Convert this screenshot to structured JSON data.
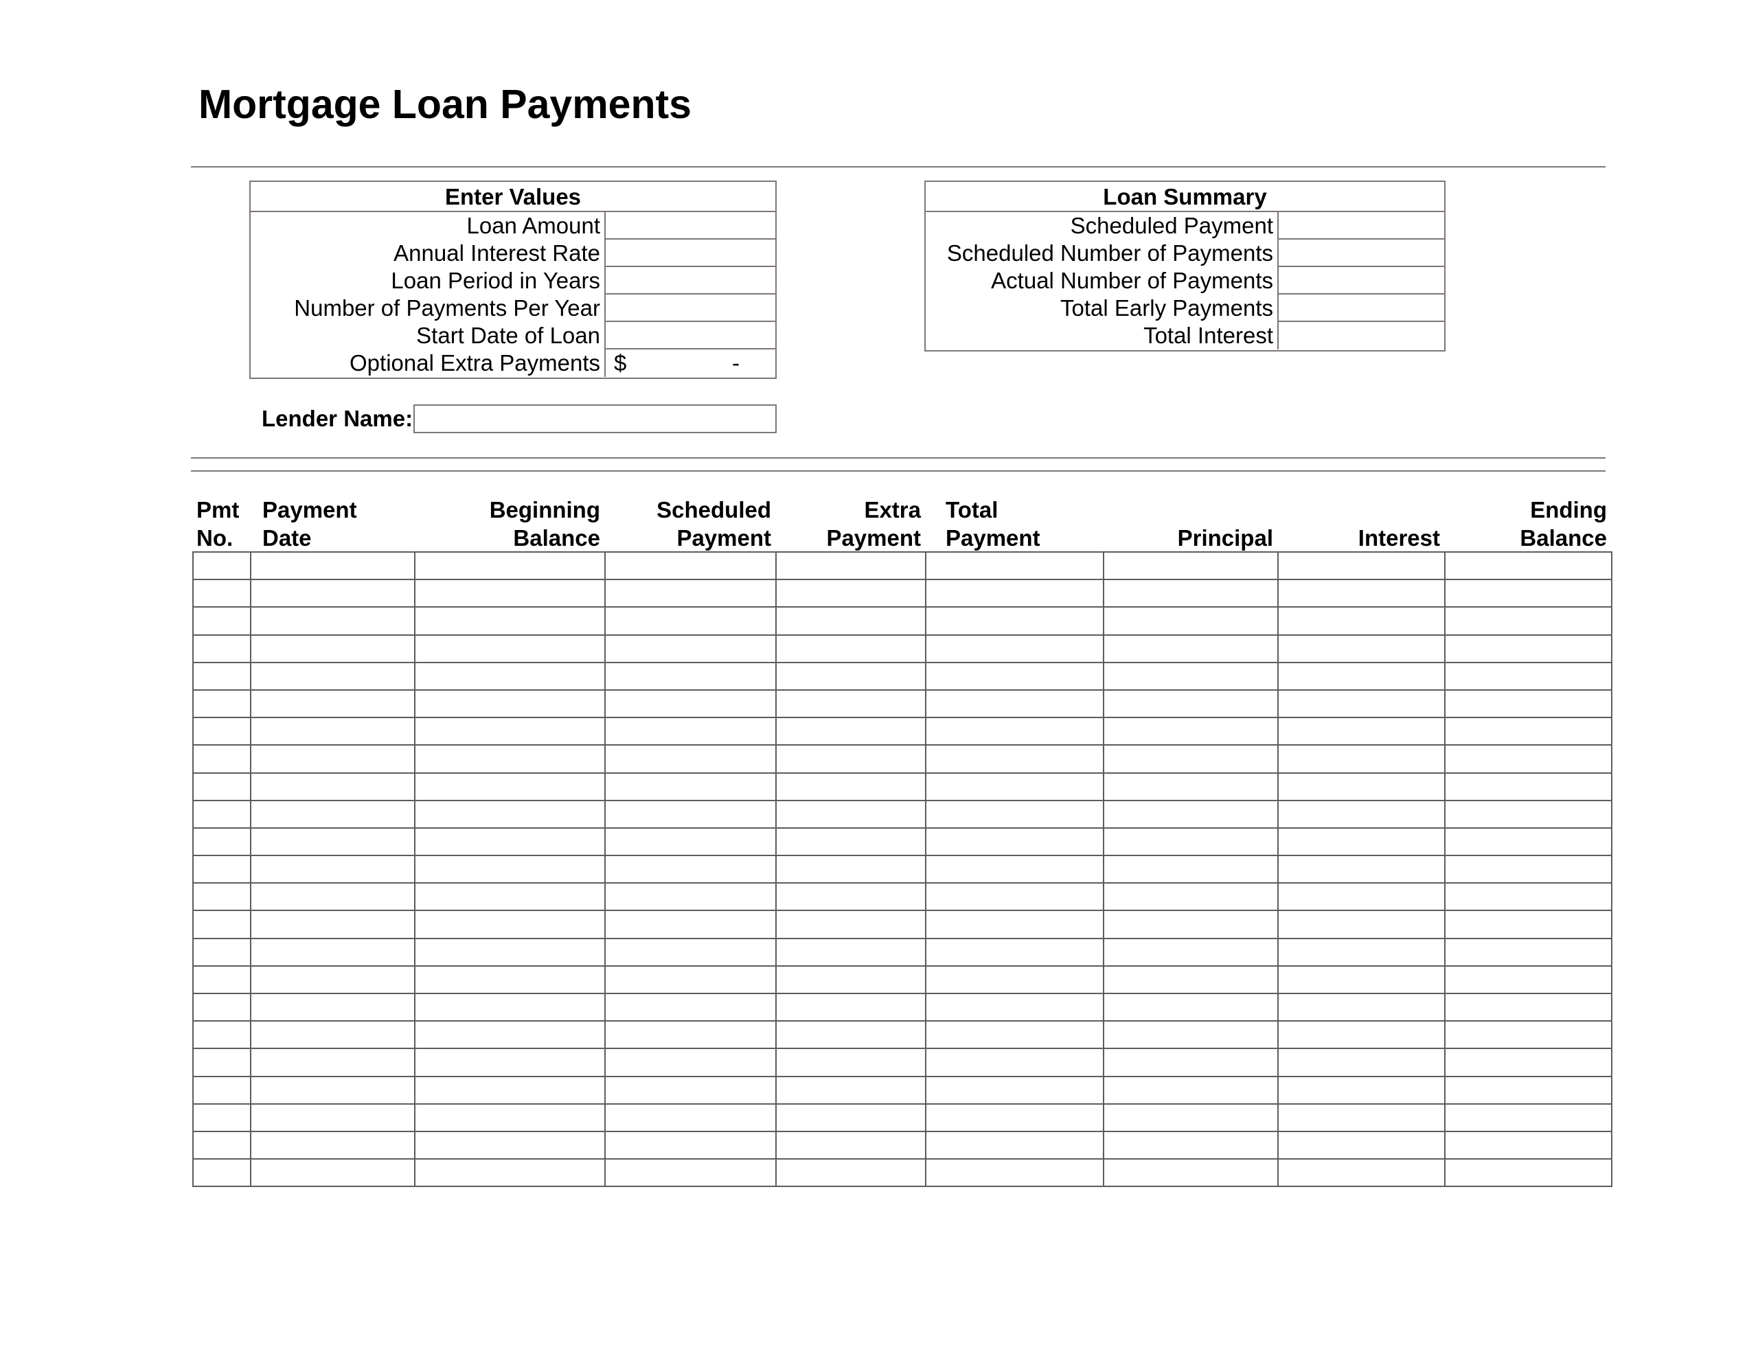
{
  "title": "Mortgage Loan Payments",
  "enter_values": {
    "heading": "Enter Values",
    "fields": [
      {
        "label": "Loan Amount",
        "value": ""
      },
      {
        "label": "Annual Interest Rate",
        "value": ""
      },
      {
        "label": "Loan Period in Years",
        "value": ""
      },
      {
        "label": "Number of Payments Per Year",
        "value": ""
      },
      {
        "label": "Start Date of Loan",
        "value": ""
      },
      {
        "label": "Optional Extra Payments",
        "currency": "$",
        "value": "-"
      }
    ]
  },
  "loan_summary": {
    "heading": "Loan Summary",
    "fields": [
      {
        "label": "Scheduled Payment",
        "value": ""
      },
      {
        "label": "Scheduled Number of Payments",
        "value": ""
      },
      {
        "label": "Actual Number of Payments",
        "value": ""
      },
      {
        "label": "Total Early Payments",
        "value": ""
      },
      {
        "label": "Total Interest",
        "value": ""
      }
    ]
  },
  "lender": {
    "label": "Lender Name:",
    "value": ""
  },
  "schedule": {
    "columns": [
      {
        "line1": "Pmt",
        "line2": "No."
      },
      {
        "line1": "",
        "line2": "Payment Date"
      },
      {
        "line1": "Beginning",
        "line2": "Balance"
      },
      {
        "line1": "Scheduled",
        "line2": "Payment"
      },
      {
        "line1": "Extra",
        "line2": "Payment"
      },
      {
        "line1": "",
        "line2": "Total Payment"
      },
      {
        "line1": "",
        "line2": "Principal"
      },
      {
        "line1": "",
        "line2": "Interest"
      },
      {
        "line1": "Ending",
        "line2": "Balance"
      }
    ],
    "row_count": 23,
    "rows": []
  }
}
